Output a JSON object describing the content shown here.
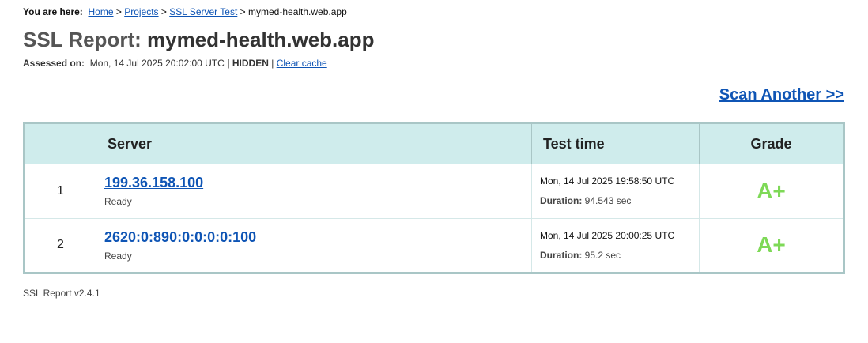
{
  "breadcrumb": {
    "label": "You are here:",
    "home": "Home",
    "projects": "Projects",
    "ssl_server_test": "SSL Server Test",
    "current": "mymed-health.web.app",
    "separator": ">"
  },
  "report": {
    "title_prefix": "SSL Report:",
    "host": "mymed-health.web.app",
    "assessed_label": "Assessed on:",
    "assessed_value": "Mon, 14 Jul 2025 20:02:00 UTC",
    "pipe": "|",
    "hidden_label": "HIDDEN",
    "clear_cache": "Clear cache"
  },
  "scan_another": "Scan Another >>",
  "table": {
    "headers": {
      "server": "Server",
      "test_time": "Test time",
      "grade": "Grade"
    },
    "rows": [
      {
        "num": "1",
        "server": "199.36.158.100",
        "status": "Ready",
        "time": "Mon, 14 Jul 2025 19:58:50 UTC",
        "duration_label": "Duration:",
        "duration_value": "94.543 sec",
        "grade": "A+"
      },
      {
        "num": "2",
        "server": "2620:0:890:0:0:0:0:100",
        "status": "Ready",
        "time": "Mon, 14 Jul 2025 20:00:25 UTC",
        "duration_label": "Duration:",
        "duration_value": "95.2 sec",
        "grade": "A+"
      }
    ]
  },
  "footer": "SSL Report v2.4.1",
  "colors": {
    "link": "#0f55b5",
    "grade_a_plus": "#7ed957",
    "header_bg": "#cfecec",
    "table_border": "#a9c6c6"
  }
}
